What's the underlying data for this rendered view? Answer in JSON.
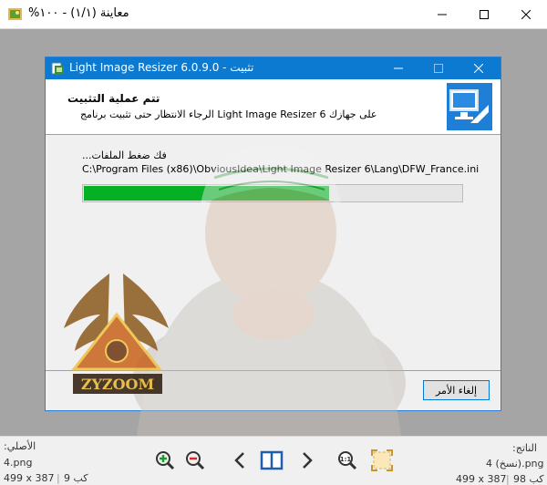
{
  "window": {
    "title": "%معاينة (١/١) - ١٠٠",
    "minimize_glyph": "—",
    "maximize_glyph": "☐",
    "close_glyph": "✕"
  },
  "dialog": {
    "title": "Light Image Resizer 6.0.9.0 - تثبيت",
    "header_title": "تتم عملية التثبيت",
    "header_subtitle": "الرجاء الانتظار حتى تثبيت برنامج Light Image Resizer 6 على جهازك",
    "status_label": "...فك ضغط الملفات",
    "file_path": "C:\\Program Files (x86)\\ObviousIdea\\Light Image Resizer 6\\Lang\\DFW_France.ini",
    "progress": 0.65,
    "cancel_label": "إلغاء الأمر",
    "accent": "#0b7ad0",
    "progress_color": "#06b025"
  },
  "watermark": {
    "text": "ZYZOOM"
  },
  "bottom_bar": {
    "left": {
      "label": ":الأصلي",
      "filename": "4.png",
      "dims": "499 x 387",
      "size": "9 كب"
    },
    "right": {
      "label": ":الناتج",
      "filename": "4 (نسخ).png",
      "dims": "499 x 387",
      "size": "98 كب"
    },
    "tools": [
      "zoom-in-icon",
      "zoom-out-icon",
      "chevron-left-icon",
      "compare-split-icon",
      "chevron-right-icon",
      "actual-size-icon",
      "fit-screen-icon"
    ]
  }
}
